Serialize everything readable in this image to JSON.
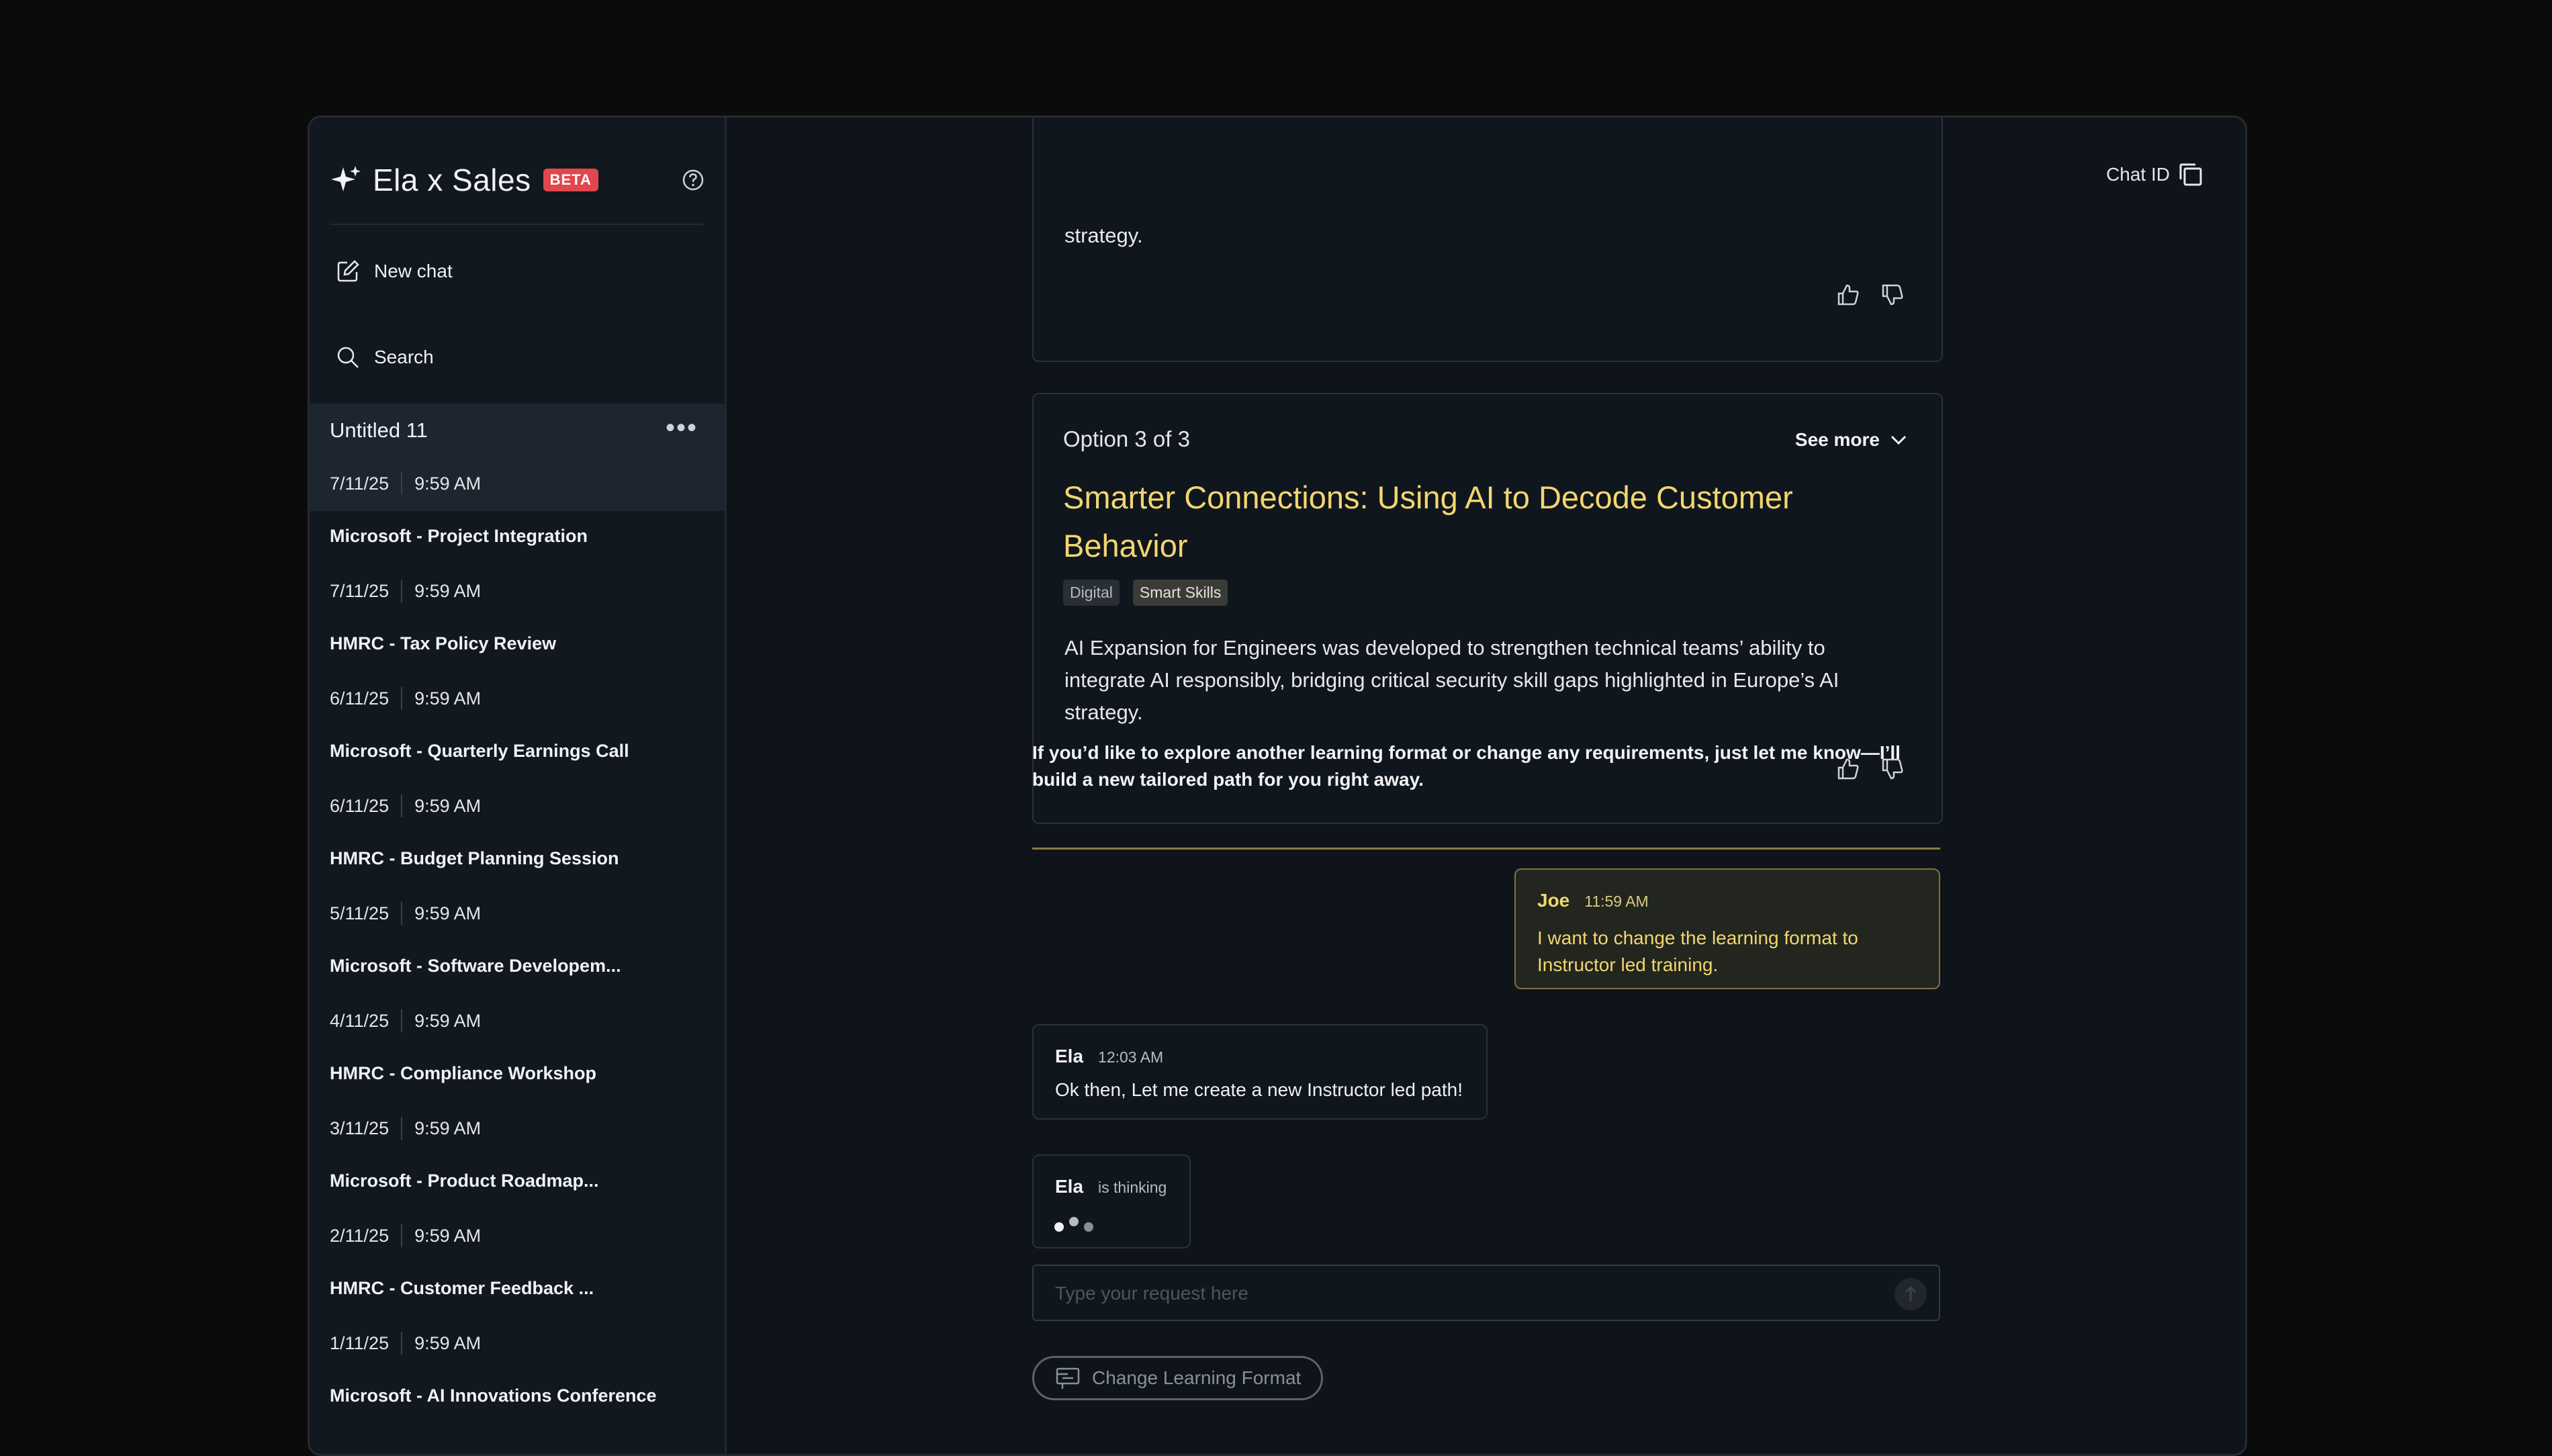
{
  "sidebar": {
    "brand_title": "Ela x Sales",
    "beta_badge": "BETA",
    "new_chat": "New chat",
    "search": "Search",
    "history": [
      {
        "title": "Untitled 11",
        "date": "7/11/25",
        "time": "9:59 AM",
        "active": true
      },
      {
        "title": "Microsoft - Project Integration",
        "date": "7/11/25",
        "time": "9:59 AM"
      },
      {
        "title": "HMRC - Tax Policy Review",
        "date": "6/11/25",
        "time": "9:59 AM"
      },
      {
        "title": "Microsoft - Quarterly Earnings Call",
        "date": "6/11/25",
        "time": "9:59 AM"
      },
      {
        "title": "HMRC - Budget Planning Session",
        "date": "5/11/25",
        "time": "9:59 AM"
      },
      {
        "title": "Microsoft - Software Developem...",
        "date": "4/11/25",
        "time": "9:59 AM"
      },
      {
        "title": "HMRC - Compliance Workshop",
        "date": "3/11/25",
        "time": "9:59 AM"
      },
      {
        "title": "Microsoft - Product Roadmap...",
        "date": "2/11/25",
        "time": "9:59 AM"
      },
      {
        "title": "HMRC - Customer Feedback ...",
        "date": "1/11/25",
        "time": "9:59 AM"
      },
      {
        "title": "Microsoft - AI Innovations Conference",
        "date": "",
        "time": ""
      }
    ]
  },
  "header": {
    "chat_id_label": "Chat ID"
  },
  "prev_card": {
    "text_tail": "strategy."
  },
  "option_card": {
    "label": "Option 3 of 3",
    "see_more": "See more",
    "title": "Smarter Connections: Using AI to Decode Customer Behavior",
    "tags": [
      "Digital",
      "Smart Skills"
    ],
    "description": "AI Expansion for Engineers was developed to strengthen technical teams’ ability to integrate AI responsibly, bridging critical security skill gaps highlighted in Europe’s AI strategy."
  },
  "followup_text": "If you’d like to explore another learning format or change any requirements, just let me know—I’ll build a new tailored path for you right away.",
  "user_message": {
    "name": "Joe",
    "time": "11:59 AM",
    "text": "I want to change the learning format to Instructor led training."
  },
  "ela_message": {
    "name": "Ela",
    "time": "12:03 AM",
    "text": "Ok then, Let me create a new Instructor led path!"
  },
  "thinking": {
    "name": "Ela",
    "status": "is thinking"
  },
  "composer": {
    "placeholder": "Type your request here",
    "change_format_button": "Change Learning Format"
  },
  "colors": {
    "accent_gold": "#f2d66f",
    "beta_red": "#e1474d",
    "background": "#0f141b"
  },
  "icons": [
    "sparkle-icon",
    "help-icon",
    "edit-icon",
    "search-icon",
    "more-icon",
    "copy-icon",
    "thumbs-up-icon",
    "thumbs-down-icon",
    "chevron-down-icon",
    "send-icon",
    "format-icon"
  ]
}
